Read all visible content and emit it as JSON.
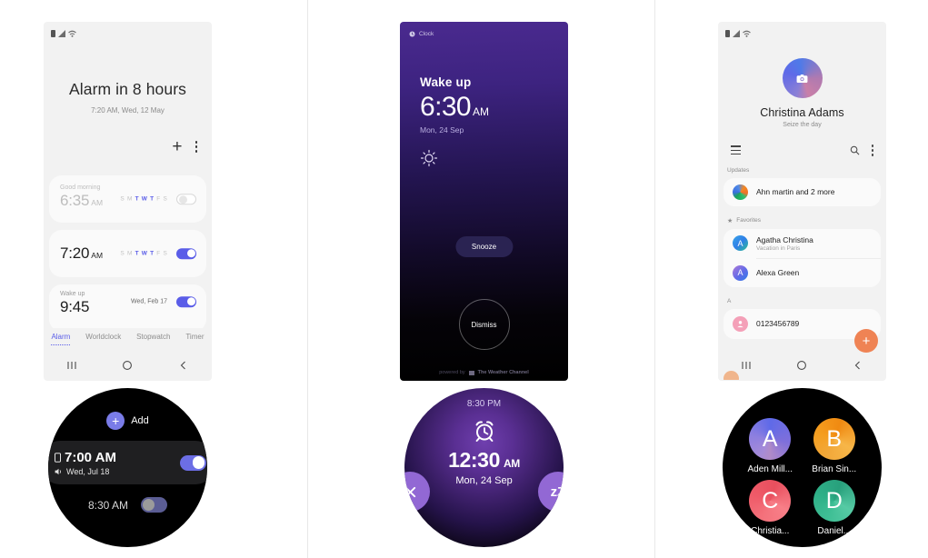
{
  "phone_alarm_list": {
    "status_icons": [
      "battery-icon",
      "signal-icon",
      "wifi-icon"
    ],
    "hero_title": "Alarm in 8 hours",
    "hero_subtitle": "7:20 AM, Wed, 12 May",
    "add_icon": "plus-icon",
    "more_icon": "kebab-menu-icon",
    "alarms": [
      {
        "label": "Good morning",
        "time": "6:35",
        "ampm": "AM",
        "days": [
          "S",
          "M",
          "T",
          "W",
          "T",
          "F",
          "S"
        ],
        "active_days": [
          2,
          3,
          4
        ],
        "enabled": false
      },
      {
        "label": "",
        "time": "7:20",
        "ampm": "AM",
        "days": [
          "S",
          "M",
          "T",
          "W",
          "T",
          "F",
          "S"
        ],
        "active_days": [
          2,
          3,
          4
        ],
        "enabled": true
      },
      {
        "label": "Wake up",
        "time": "9:45",
        "ampm": "",
        "date": "Wed, Feb 17",
        "enabled": true
      }
    ],
    "tabs": [
      {
        "label": "Alarm",
        "active": true
      },
      {
        "label": "Worldclock",
        "active": false
      },
      {
        "label": "Stopwatch",
        "active": false
      },
      {
        "label": "Timer",
        "active": false
      }
    ],
    "nav": [
      "recents-icon",
      "home-icon",
      "back-icon"
    ]
  },
  "phone_alarm_ringing": {
    "app_chip_icon": "clock-icon",
    "app_chip_label": "Clock",
    "alarm_name": "Wake up",
    "time": "6:30",
    "ampm": "AM",
    "date": "Mon, 24 Sep",
    "weather_icon": "sun-icon",
    "snooze_label": "Snooze",
    "dismiss_label": "Dismiss",
    "footer_prefix": "powered by",
    "footer_brand": "The Weather Channel",
    "accent_top": "#4a2a8f"
  },
  "phone_contacts": {
    "status_icons": [
      "battery-icon",
      "signal-icon",
      "wifi-icon"
    ],
    "avatar_icon": "camera-icon",
    "profile_name": "Christina  Adams",
    "profile_status": "Seize the day",
    "menu_icon": "hamburger-icon",
    "search_icon": "search-icon",
    "more_icon": "kebab-menu-icon",
    "sections": [
      {
        "title": "Updates",
        "star": false,
        "rows": [
          {
            "avatar": "updates-icon",
            "name": "Ahn martin and 2 more",
            "sub": "",
            "initial": ""
          }
        ]
      },
      {
        "title": "Favorites",
        "star": true,
        "rows": [
          {
            "avatar": "letter-avatar",
            "initial": "A",
            "name": "Agatha Christina",
            "sub": "Vacation in Paris",
            "color": "#2f7fe8"
          },
          {
            "avatar": "letter-avatar",
            "initial": "A",
            "name": "Alexa Green",
            "sub": "",
            "color": "#2f7fe8"
          }
        ]
      },
      {
        "title": "A",
        "star": false,
        "rows": [
          {
            "avatar": "person-icon",
            "initial": "",
            "name": "0123456789",
            "sub": "",
            "color": "#f4a0b8"
          }
        ]
      }
    ],
    "fab_icon": "plus-icon",
    "fab_color": "#ef8354",
    "nav": [
      "recents-icon",
      "home-icon",
      "back-icon"
    ]
  },
  "watch_alarm_list": {
    "add_icon": "plus-icon",
    "add_label": "Add",
    "alarms": [
      {
        "time": "7:00 AM",
        "lead_icon": "vibrate-icon",
        "sub_icon": "sound-icon",
        "sub": "Wed, Jul 18",
        "enabled": true
      },
      {
        "time": "8:30 AM",
        "enabled": false
      }
    ]
  },
  "watch_alarm_ringing": {
    "current_time": "8:30 PM",
    "alarm_icon": "alarm-clock-icon",
    "time": "12:30",
    "ampm": "AM",
    "date": "Mon, 24 Sep",
    "dismiss_icon": "close-icon",
    "snooze_label": "zZ"
  },
  "watch_contacts": {
    "contacts": [
      {
        "initial": "A",
        "name": "Aden Mill...",
        "color": "#8d7fe0"
      },
      {
        "initial": "B",
        "name": "Brian Sin...",
        "color": "#f59e1f"
      },
      {
        "initial": "C",
        "name": "Christia...",
        "color": "#ef5a68"
      },
      {
        "initial": "D",
        "name": "Daniel...",
        "color": "#2fb088"
      }
    ]
  }
}
